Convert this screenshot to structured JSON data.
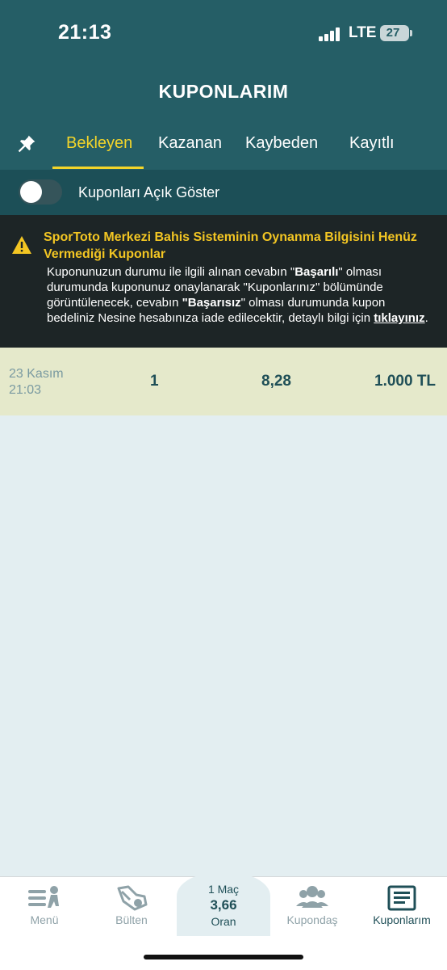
{
  "status_bar": {
    "time": "21:13",
    "network": "LTE",
    "battery": "27"
  },
  "header": {
    "title": "KUPONLARIM"
  },
  "tabs": [
    {
      "label": "Bekleyen",
      "active": true
    },
    {
      "label": "Kazanan",
      "active": false
    },
    {
      "label": "Kaybeden",
      "active": false
    },
    {
      "label": "Kayıtlı",
      "active": false
    }
  ],
  "toggle": {
    "label": "Kuponları Açık Göster",
    "on": false
  },
  "notice": {
    "title": "SporToto Merkezi Bahis Sisteminin Oynanma Bilgisini Henüz Vermediği Kuponlar",
    "body_1": "Kuponunuzun durumu ile ilgili alınan cevabın \"",
    "bold_1": "Başarılı",
    "body_2": "\" olması durumunda kuponunuz onaylanarak \"Kuponlarınız\" bölümünde görüntülenecek, cevabın ",
    "bold_2": "\"Başarısız",
    "body_3": "\" olması durumunda kupon bedeliniz Nesine hesabınıza iade edilecektir, detaylı bilgi için ",
    "link": "tıklayınız",
    "body_4": "."
  },
  "coupons": [
    {
      "date": "23 Kasım",
      "time": "21:03",
      "match_count": "1",
      "odds": "8,28",
      "amount": "1.000 TL"
    }
  ],
  "bottom_nav": {
    "items": [
      {
        "label": "Menü",
        "icon": "menu-icon"
      },
      {
        "label": "Bülten",
        "icon": "bulletin-icon"
      },
      {
        "label": "Kupondaş",
        "icon": "people-icon"
      },
      {
        "label": "Kuponlarım",
        "icon": "coupons-icon",
        "active": true
      }
    ],
    "slip": {
      "match_count": "1 Maç",
      "odds": "3,66",
      "label": "Oran"
    }
  },
  "colors": {
    "header": "#255e66",
    "accent": "#f3d52a",
    "notice_bg": "#1d2526",
    "coupon_row": "#e5e9cb",
    "page_bg": "#e3eef1"
  }
}
